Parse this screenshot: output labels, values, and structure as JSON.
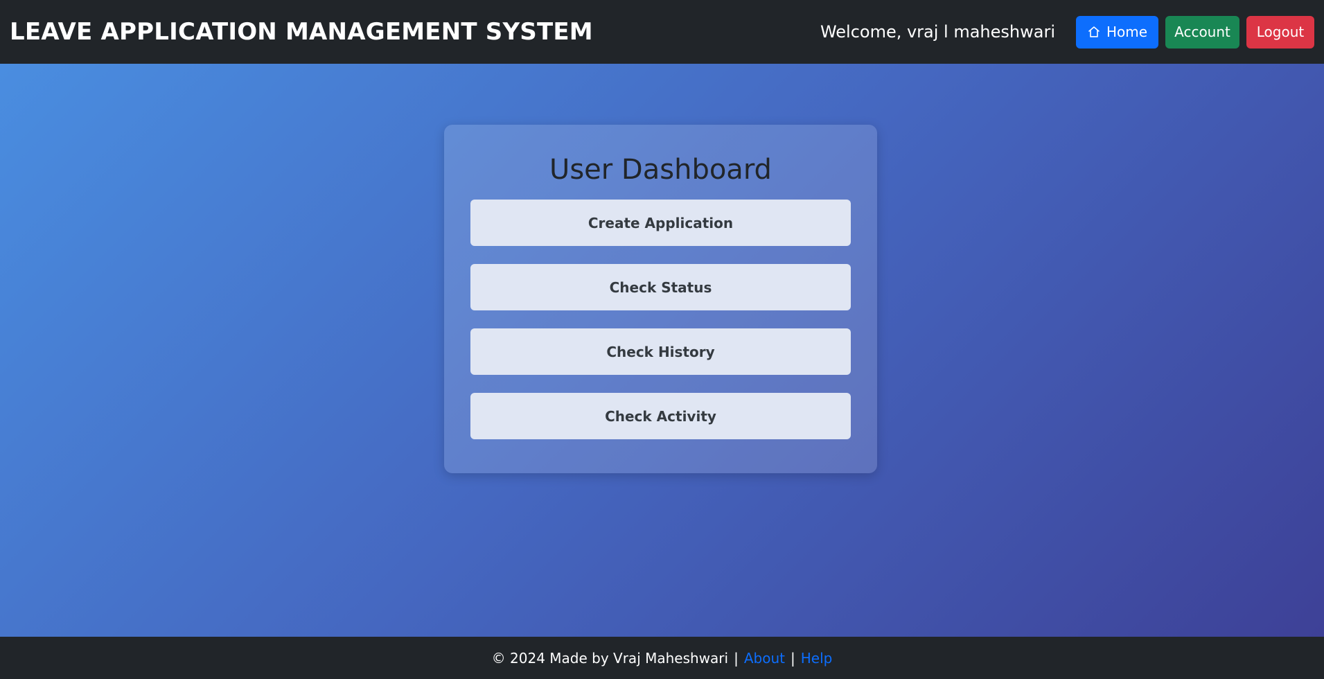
{
  "navbar": {
    "brand": "LEAVE APPLICATION MANAGEMENT SYSTEM",
    "welcome": "Welcome, vraj l maheshwari",
    "home_label": "Home",
    "home_icon": "home-icon",
    "account_label": "Account",
    "logout_label": "Logout"
  },
  "dashboard": {
    "title": "User Dashboard",
    "buttons": [
      {
        "label": "Create Application"
      },
      {
        "label": "Check Status"
      },
      {
        "label": "Check History"
      },
      {
        "label": "Check Activity"
      }
    ]
  },
  "footer": {
    "copyright": "© 2024 Made by Vraj Maheshwari",
    "separator": "|",
    "about_label": "About",
    "help_label": "Help"
  },
  "colors": {
    "navbar_bg": "#212529",
    "home_button": "#0d6efd",
    "account_button": "#198754",
    "logout_button": "#dc3545",
    "link": "#0d6efd"
  }
}
